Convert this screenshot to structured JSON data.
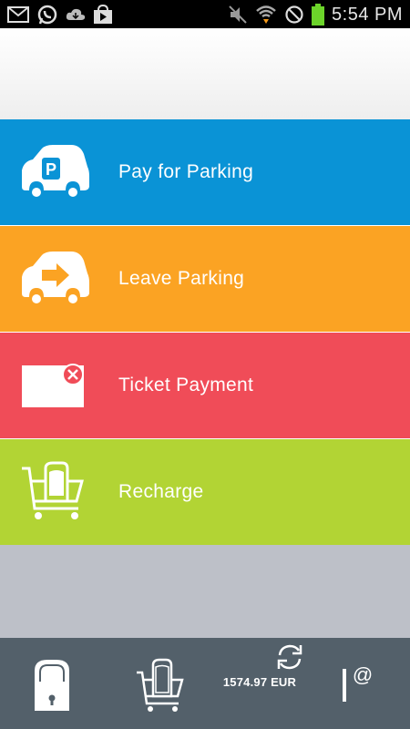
{
  "status_bar": {
    "time": "5:54 PM",
    "left_icons": [
      "mail-icon",
      "whatsapp-icon",
      "cloud-download-icon",
      "play-store-icon"
    ],
    "right_icons": [
      "mute-icon",
      "wifi-icon",
      "no-sim-icon",
      "battery-icon"
    ],
    "battery_color": "#6cd42a"
  },
  "menu": {
    "items": [
      {
        "label": "Pay for Parking",
        "icon": "parking-car-icon",
        "color": "#0a93d6"
      },
      {
        "label": "Leave Parking",
        "icon": "leave-parking-car-icon",
        "color": "#fba323"
      },
      {
        "label": "Ticket Payment",
        "icon": "ticket-icon",
        "color": "#f04c58"
      },
      {
        "label": "Recharge",
        "icon": "recharge-cart-icon",
        "color": "#b2d434"
      }
    ]
  },
  "bottom_bar": {
    "balance": "1574.97 EUR",
    "icons": [
      "lock-icon",
      "cart-icon",
      "refresh-icon",
      "contact-icon"
    ],
    "background": "#53606a"
  }
}
